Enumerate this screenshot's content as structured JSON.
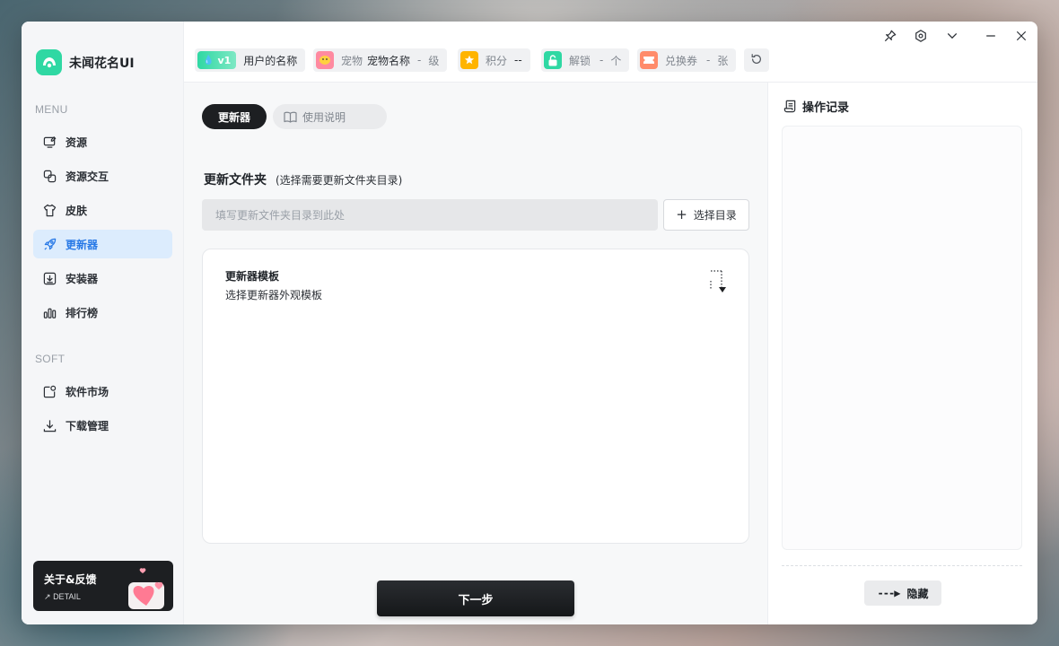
{
  "app": {
    "title": "未闻花名UI"
  },
  "sidebar": {
    "menu_section": "MENU",
    "soft_section": "SOFT",
    "menu_items": [
      {
        "label": "资源",
        "icon": "edit-screen-icon",
        "active": false
      },
      {
        "label": "资源交互",
        "icon": "copy-icon",
        "active": false
      },
      {
        "label": "皮肤",
        "icon": "shirt-icon",
        "active": false
      },
      {
        "label": "更新器",
        "icon": "rocket-icon",
        "active": true
      },
      {
        "label": "安装器",
        "icon": "download-box-icon",
        "active": false
      },
      {
        "label": "排行榜",
        "icon": "bar-chart-icon",
        "active": false
      }
    ],
    "soft_items": [
      {
        "label": "软件市场",
        "icon": "app-store-icon"
      },
      {
        "label": "下载管理",
        "icon": "download-icon"
      }
    ],
    "about": {
      "title": "关于&反馈",
      "detail": "DETAIL"
    }
  },
  "topbar": {
    "user": {
      "level": "v1",
      "name": "用户的名称"
    },
    "pet": {
      "label": "宠物",
      "name": "宠物名称",
      "value": "-",
      "unit": "级"
    },
    "points": {
      "label": "积分",
      "value": "--"
    },
    "unlock": {
      "label": "解锁",
      "value": "-",
      "unit": "个"
    },
    "coupon": {
      "label": "兑换券",
      "value": "-",
      "unit": "张"
    }
  },
  "main": {
    "tabs": [
      {
        "label": "更新器",
        "active": true
      },
      {
        "label": "使用说明",
        "active": false
      }
    ],
    "folder": {
      "title": "更新文件夹",
      "hint": "(选择需要更新文件夹目录)",
      "placeholder": "填写更新文件夹目录到此处",
      "value": "",
      "pick_button": "选择目录"
    },
    "template": {
      "title": "更新器模板",
      "desc": "选择更新器外观模板"
    },
    "next_button": "下一步"
  },
  "log": {
    "title": "操作记录",
    "hide_button": "隐藏"
  },
  "colors": {
    "accent": "#2879e6",
    "active_bg": "#dcecfd",
    "brand": "#2fd8a3",
    "dark": "#1d1f22"
  }
}
